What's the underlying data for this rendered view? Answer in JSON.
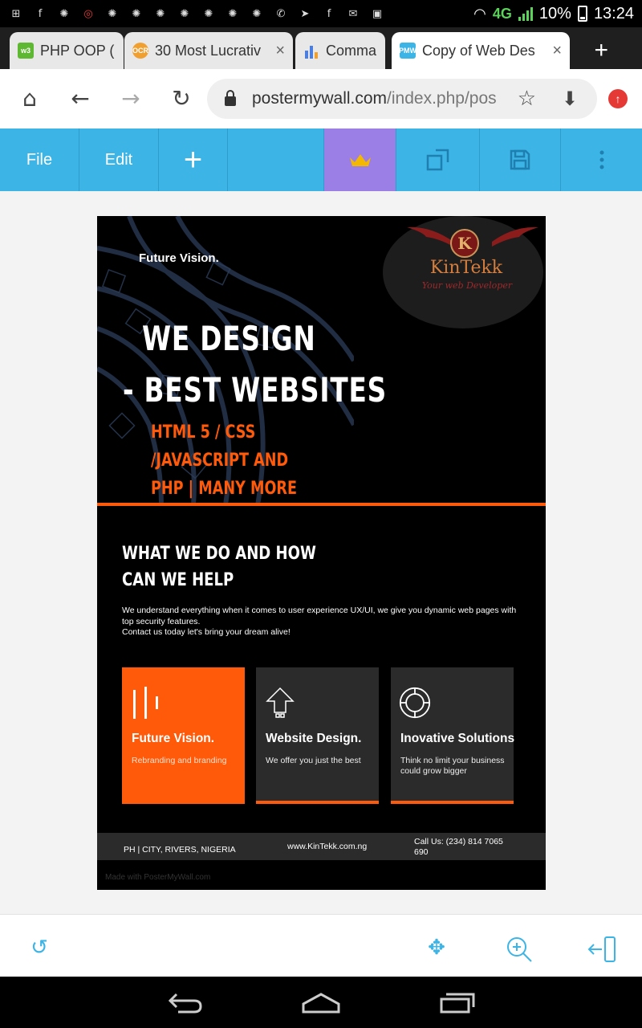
{
  "status_bar": {
    "network": "4G",
    "battery": "10%",
    "time": "13:24",
    "notification_icons": [
      "plus-icon",
      "facebook-icon",
      "nbc-icon",
      "opera-icon",
      "nbc-icon",
      "nbc-icon",
      "nbc-icon",
      "nbc-icon",
      "nbc-icon",
      "nbc-icon",
      "nbc-icon",
      "whatsapp-icon",
      "telegram-icon",
      "facebook-icon",
      "gmail-icon",
      "gallery-icon"
    ]
  },
  "tabs": [
    {
      "title": "PHP OOP (",
      "favicon_color": "#5fb832",
      "active": false
    },
    {
      "title": "30 Most Lucrativ",
      "favicon_color": "#f0a030",
      "active": false,
      "close": "×"
    },
    {
      "title": "Comma",
      "favicon_color": "#4a7ee0",
      "active": false
    },
    {
      "title": "Copy of Web Des",
      "favicon_color": "#3cb4e5",
      "active": true,
      "close": "×"
    }
  ],
  "new_tab_label": "+",
  "address": {
    "host": "postermywall.com",
    "path": "/index.php/pos"
  },
  "editor_toolbar": {
    "file": "File",
    "edit": "Edit",
    "add": "+"
  },
  "poster": {
    "brand": "Future Vision.",
    "logo_letter": "K",
    "logo_name": "KinTekk",
    "logo_tagline": "Your web Developer",
    "headline_1": "WE DESIGN",
    "headline_2": "- BEST WEBSITES",
    "sub_1": "HTML 5 / CSS",
    "sub_2": "/JAVASCRIPT AND",
    "sub_3": "PHP | MANY MORE",
    "what_1": "WHAT WE DO AND HOW",
    "what_2": "CAN WE HELP",
    "para_1": "We understand everything when it comes to user experience UX/UI, we give you dynamic web pages with top security features.",
    "para_2": "Contact us today let's bring your dream alive!",
    "cards": [
      {
        "title": "Future Vision.",
        "text": "Rebranding and branding",
        "icon": "bars-icon"
      },
      {
        "title": "Website Design.",
        "text": "We offer you just the best",
        "icon": "arrow-up-icon"
      },
      {
        "title": "Inovative Solutions",
        "text": "Think no limit your business could grow bigger",
        "icon": "ring-icon"
      }
    ],
    "footer_left": "PH | CITY, RIVERS, NIGERIA",
    "footer_mid": "www.KinTekk.com.ng",
    "footer_right_1": "Call Us: (234) 814 7065",
    "footer_right_2": "690",
    "watermark": "Made with PosterMyWall.com"
  },
  "colors": {
    "toolbar": "#3cb4e5",
    "premium": "#9b7fe6",
    "accent_orange": "#ff5a0a"
  }
}
